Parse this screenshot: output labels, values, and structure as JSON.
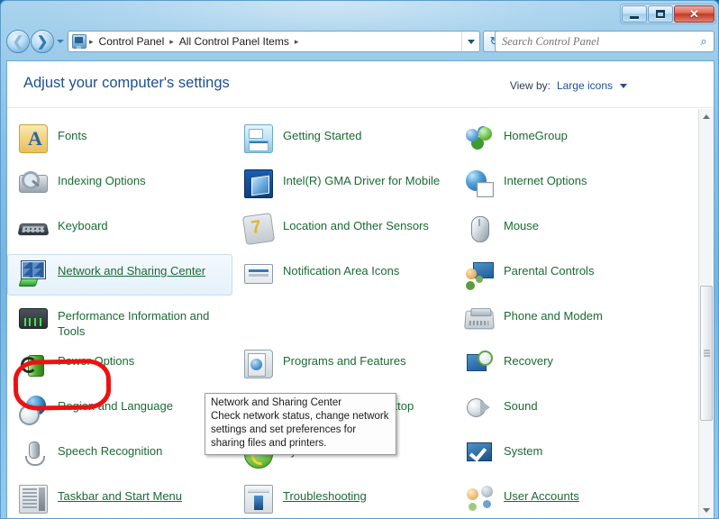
{
  "window": {
    "buttons": {
      "minimize": "Minimize",
      "maximize": "Maximize",
      "close": "Close"
    }
  },
  "navbar": {
    "back_label": "Back",
    "forward_label": "Forward",
    "recent_pages_label": "Recent pages",
    "breadcrumbs": [
      "Control Panel",
      "All Control Panel Items"
    ],
    "separator": "▸",
    "refresh_label": "↻",
    "address_dropdown_label": "Previous locations"
  },
  "search": {
    "placeholder": "Search Control Panel",
    "icon": "search-icon",
    "glyph": "⌕"
  },
  "header": {
    "title": "Adjust your computer's settings",
    "view_by_label": "View by:",
    "view_by_value": "Large icons"
  },
  "items": [
    {
      "label": "Fonts",
      "icon": "ic-fonts",
      "col": 1,
      "row": 1,
      "state": "normal"
    },
    {
      "label": "Getting Started",
      "icon": "ic-getting",
      "col": 2,
      "row": 1,
      "state": "normal"
    },
    {
      "label": "HomeGroup",
      "icon": "ic-homegroup",
      "col": 3,
      "row": 1,
      "state": "normal"
    },
    {
      "label": "Indexing Options",
      "icon": "ic-indexing",
      "col": 1,
      "row": 2,
      "state": "normal"
    },
    {
      "label": "Intel(R) GMA Driver for Mobile",
      "icon": "ic-intel",
      "col": 2,
      "row": 2,
      "state": "normal"
    },
    {
      "label": "Internet Options",
      "icon": "ic-internet",
      "col": 3,
      "row": 2,
      "state": "normal"
    },
    {
      "label": "Keyboard",
      "icon": "ic-keyboard",
      "col": 1,
      "row": 3,
      "state": "normal"
    },
    {
      "label": "Location and Other Sensors",
      "icon": "ic-location",
      "col": 2,
      "row": 3,
      "state": "normal"
    },
    {
      "label": "Mouse",
      "icon": "ic-mouse",
      "col": 3,
      "row": 3,
      "state": "normal"
    },
    {
      "label": "Network and Sharing Center",
      "icon": "ic-network",
      "col": 1,
      "row": 4,
      "state": "hovered"
    },
    {
      "label": "Notification Area Icons",
      "icon": "ic-notif",
      "col": 2,
      "row": 4,
      "state": "normal"
    },
    {
      "label": "Parental Controls",
      "icon": "ic-parental",
      "col": 3,
      "row": 4,
      "state": "normal"
    },
    {
      "label": "Performance Information and Tools",
      "icon": "ic-perf",
      "col": 1,
      "row": 5,
      "state": "normal"
    },
    {
      "label": "",
      "icon": "",
      "col": 2,
      "row": 5,
      "state": "blank"
    },
    {
      "label": "Phone and Modem",
      "icon": "ic-phone",
      "col": 3,
      "row": 5,
      "state": "normal"
    },
    {
      "label": "Power Options",
      "icon": "ic-power",
      "col": 1,
      "row": 6,
      "state": "normal"
    },
    {
      "label": "Programs and Features",
      "icon": "ic-programs",
      "col": 2,
      "row": 6,
      "state": "normal"
    },
    {
      "label": "Recovery",
      "icon": "ic-recovery",
      "col": 3,
      "row": 6,
      "state": "normal"
    },
    {
      "label": "Region and Language",
      "icon": "ic-region",
      "col": 1,
      "row": 7,
      "state": "normal"
    },
    {
      "label": "RemoteApp and Desktop Connections",
      "icon": "ic-remote",
      "col": 2,
      "row": 7,
      "state": "normal"
    },
    {
      "label": "Sound",
      "icon": "ic-sound",
      "col": 3,
      "row": 7,
      "state": "normal"
    },
    {
      "label": "Speech Recognition",
      "icon": "ic-speech",
      "col": 1,
      "row": 8,
      "state": "normal"
    },
    {
      "label": "Sync Center",
      "icon": "ic-sync",
      "col": 2,
      "row": 8,
      "state": "normal"
    },
    {
      "label": "System",
      "icon": "ic-system",
      "col": 3,
      "row": 8,
      "state": "normal"
    },
    {
      "label": "Taskbar and Start Menu",
      "icon": "ic-taskbar",
      "col": 1,
      "row": 9,
      "state": "underlined"
    },
    {
      "label": "Troubleshooting",
      "icon": "ic-trouble",
      "col": 2,
      "row": 9,
      "state": "underlined"
    },
    {
      "label": "User Accounts",
      "icon": "ic-users",
      "col": 3,
      "row": 9,
      "state": "underlined"
    }
  ],
  "tooltip": {
    "title": "Network and Sharing Center",
    "body": "Check network status, change network settings and set preferences for sharing files and printers."
  },
  "annotation": {
    "shape": "red-ellipse-highlight",
    "color": "#ee1111",
    "targets": "Network and Sharing Center"
  },
  "scrollbar": {
    "up_label": "Scroll up",
    "down_label": "Scroll down",
    "thumb_label": "Scroll thumb"
  }
}
